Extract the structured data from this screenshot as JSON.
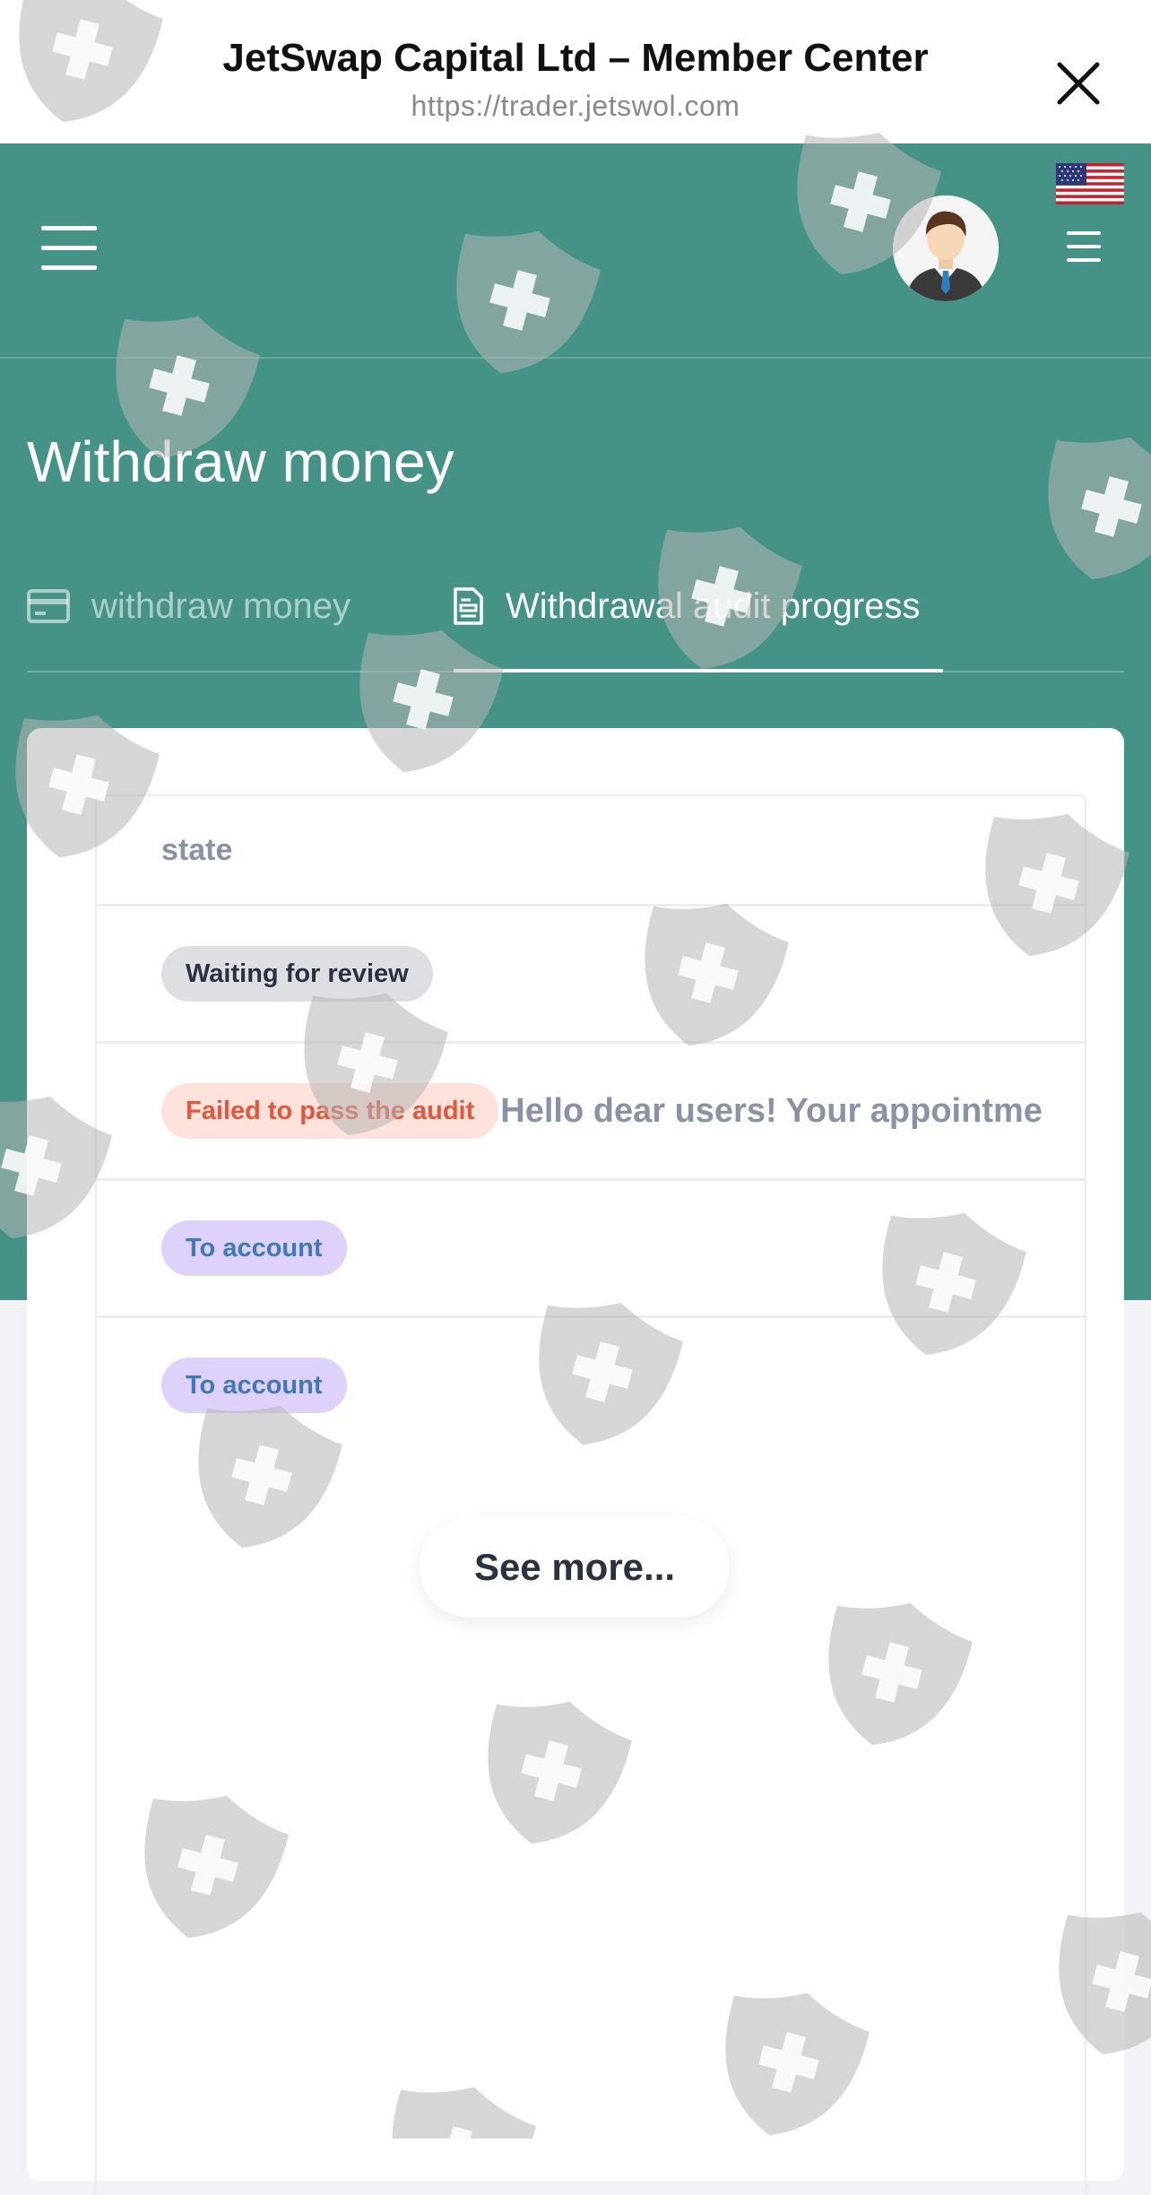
{
  "browser": {
    "title": "JetSwap Capital Ltd – Member Center",
    "url": "https://trader.jetswol.com",
    "close_icon": "close-icon"
  },
  "header": {
    "menu_icon": "hamburger-icon",
    "avatar": "user-avatar",
    "language_flag": "us-flag-icon",
    "secondary_menu_icon": "menu-icon"
  },
  "page": {
    "title": "Withdraw money",
    "tabs": [
      {
        "label": "withdraw money",
        "icon": "credit-card-icon",
        "active": false
      },
      {
        "label": "Withdrawal audit progress",
        "icon": "document-icon",
        "active": true
      }
    ]
  },
  "table": {
    "column_header": "state",
    "rows": [
      {
        "status": "Waiting for review",
        "status_color": "gray",
        "note": ""
      },
      {
        "status": "Failed to pass the audit",
        "status_color": "red",
        "note": "Hello dear users! Your appointme"
      },
      {
        "status": "To account",
        "status_color": "purple",
        "note": ""
      },
      {
        "status": "To account",
        "status_color": "purple",
        "note": ""
      }
    ]
  },
  "see_more_label": "See more...",
  "colors": {
    "header_teal": "#459386",
    "badge_gray_bg": "#dedfe3",
    "badge_red_bg": "#fde2dc",
    "badge_red_text": "#e4563c",
    "badge_purple_bg": "#ded2fb",
    "badge_purple_text": "#4078b8"
  }
}
